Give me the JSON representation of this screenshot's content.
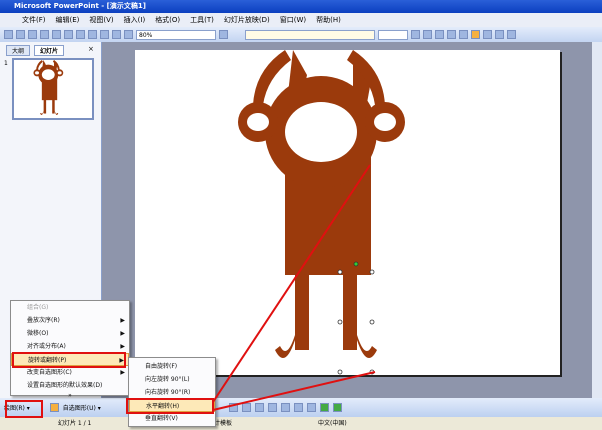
{
  "window": {
    "title": "Microsoft PowerPoint - [演示文稿1]"
  },
  "menubar": [
    "文件(F)",
    "编辑(E)",
    "视图(V)",
    "插入(I)",
    "格式(O)",
    "工具(T)",
    "幻灯片放映(D)",
    "窗口(W)",
    "帮助(H)"
  ],
  "toolbar": {
    "zoom": "80%"
  },
  "leftpanel": {
    "tabs": [
      "大纲",
      "幻灯片"
    ],
    "close": "×",
    "slide_number": "1"
  },
  "draw_menu": {
    "items": [
      {
        "label": "组合(G)",
        "disabled": true
      },
      {
        "label": "叠放次序(R)",
        "submenu": true
      },
      {
        "label": "微移(O)",
        "submenu": true
      },
      {
        "label": "对齐或分布(A)",
        "submenu": true
      },
      {
        "label": "旋转或翻转(P)",
        "submenu": true,
        "highlighted": true
      },
      {
        "label": "改变自选图形(C)",
        "submenu": true
      },
      {
        "label": "设置自选图形的默认效果(D)"
      }
    ],
    "more": "»"
  },
  "rotate_menu": {
    "items": [
      "自由旋转(F)",
      "向左旋转 90°(L)",
      "向右旋转 90°(R)",
      "水平翻转(H)",
      "垂直翻转(V)"
    ],
    "highlighted_index": 3
  },
  "drawbar": {
    "draw": "绘图(R) ▾",
    "autoshapes": "自选图形(U) ▾"
  },
  "statusbar": {
    "slide": "幻灯片 1 / 1",
    "template": "默认设计模板",
    "language": "中文(中国)"
  },
  "colors": {
    "shape": "#9b3a0c",
    "annotation": "#e01010",
    "menu_highlight": "#fde9b8"
  }
}
